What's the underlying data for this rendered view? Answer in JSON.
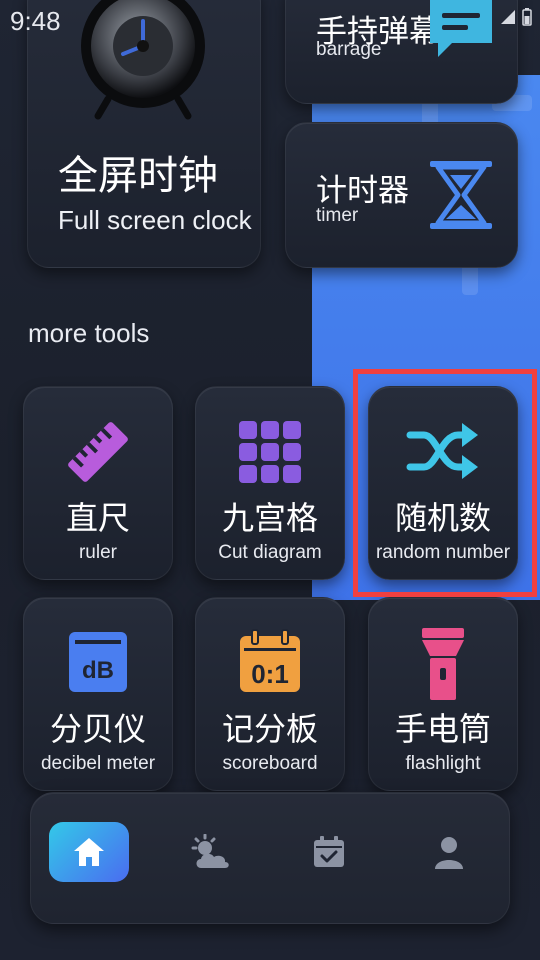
{
  "status_bar": {
    "time": "9:48"
  },
  "featured": {
    "clock": {
      "title": "全屏时钟",
      "subtitle": "Full screen clock",
      "icon": "alarm-clock-icon"
    },
    "barrage": {
      "title": "手持弹幕",
      "subtitle": "barrage",
      "icon": "chat-bubble-icon"
    },
    "timer": {
      "title": "计时器",
      "subtitle": "timer",
      "icon": "hourglass-icon"
    }
  },
  "section": {
    "title": "more tools"
  },
  "tools": [
    {
      "title": "直尺",
      "subtitle": "ruler",
      "icon": "ruler-icon",
      "color": "#b85cdc"
    },
    {
      "title": "九宫格",
      "subtitle": "Cut diagram",
      "icon": "grid-icon",
      "color": "#8a5ce0"
    },
    {
      "title": "随机数",
      "subtitle": "random number",
      "icon": "shuffle-icon",
      "color": "#3fc6e8"
    },
    {
      "title": "分贝仪",
      "subtitle": "decibel meter",
      "icon": "decibel-icon",
      "color": "#4a7ef0"
    },
    {
      "title": "记分板",
      "subtitle": "scoreboard",
      "icon": "scoreboard-icon",
      "color": "#f0a040"
    },
    {
      "title": "手电筒",
      "subtitle": "flashlight",
      "icon": "flashlight-icon",
      "color": "#e8508a"
    }
  ],
  "bottom_nav": [
    {
      "icon": "home-icon",
      "active": true
    },
    {
      "icon": "weather-icon",
      "active": false
    },
    {
      "icon": "calendar-check-icon",
      "active": false
    },
    {
      "icon": "profile-icon",
      "active": false
    }
  ],
  "colors": {
    "accent_blue": "#4a88f0",
    "highlight_red": "#f04040",
    "background": "#1f2533"
  }
}
